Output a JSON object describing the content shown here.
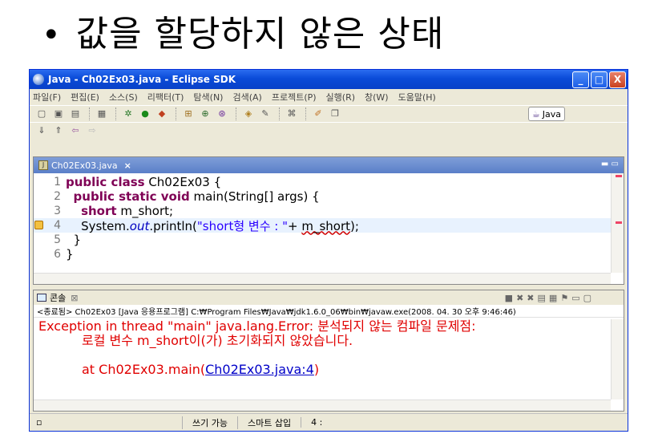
{
  "slide": {
    "title": "값을 할당하지 않은 상태"
  },
  "window": {
    "title": "Java - Ch02Ex03.java - Eclipse SDK",
    "controls": {
      "minimize": "_",
      "maximize": "□",
      "close": "X"
    }
  },
  "menu": [
    "파일(F)",
    "편집(E)",
    "소스(S)",
    "리팩터(T)",
    "탐색(N)",
    "검색(A)",
    "프로젝트(P)",
    "실행(R)",
    "창(W)",
    "도움말(H)"
  ],
  "perspective": {
    "label": "Java"
  },
  "editor": {
    "tab_label": "Ch02Ex03.java",
    "line_numbers": [
      "1",
      "2",
      "3",
      "4",
      "5",
      "6"
    ],
    "code": {
      "l1_kw": "public class",
      "l1_rest": " Ch02Ex03 {",
      "l2_kw": "public static void",
      "l2_rest": " main(String[] args) {",
      "l3_kw": "short",
      "l3_rest": " m_short;",
      "l4_a": "System.",
      "l4_out": "out",
      "l4_b": ".println(",
      "l4_str": "\"short형 변수 : \"",
      "l4_c": "+ ",
      "l4_var": "m_short",
      "l4_d": ");",
      "l5": "}",
      "l6": "}"
    }
  },
  "console": {
    "tab_label": "콘솔",
    "status": "<종료됨> Ch02Ex03 [Java 응용프로그램] C:₩Program Files₩Java₩jdk1.6.0_06₩bin₩javaw.exe(2008. 04. 30 오후 9:46:46)",
    "error_line1": "Exception in thread \"main\" java.lang.Error: 분석되지 않는 컴파일 문제점:",
    "error_line2": "로컬 변수 m_short이(가) 초기화되지 않았습니다.",
    "at_prefix": "at Ch02Ex03.main(",
    "at_link": "Ch02Ex03.java:4",
    "at_suffix": ")"
  },
  "statusbar": {
    "writable": "쓰기 가능",
    "insert_mode": "스마트 삽입",
    "position": "4 :"
  }
}
